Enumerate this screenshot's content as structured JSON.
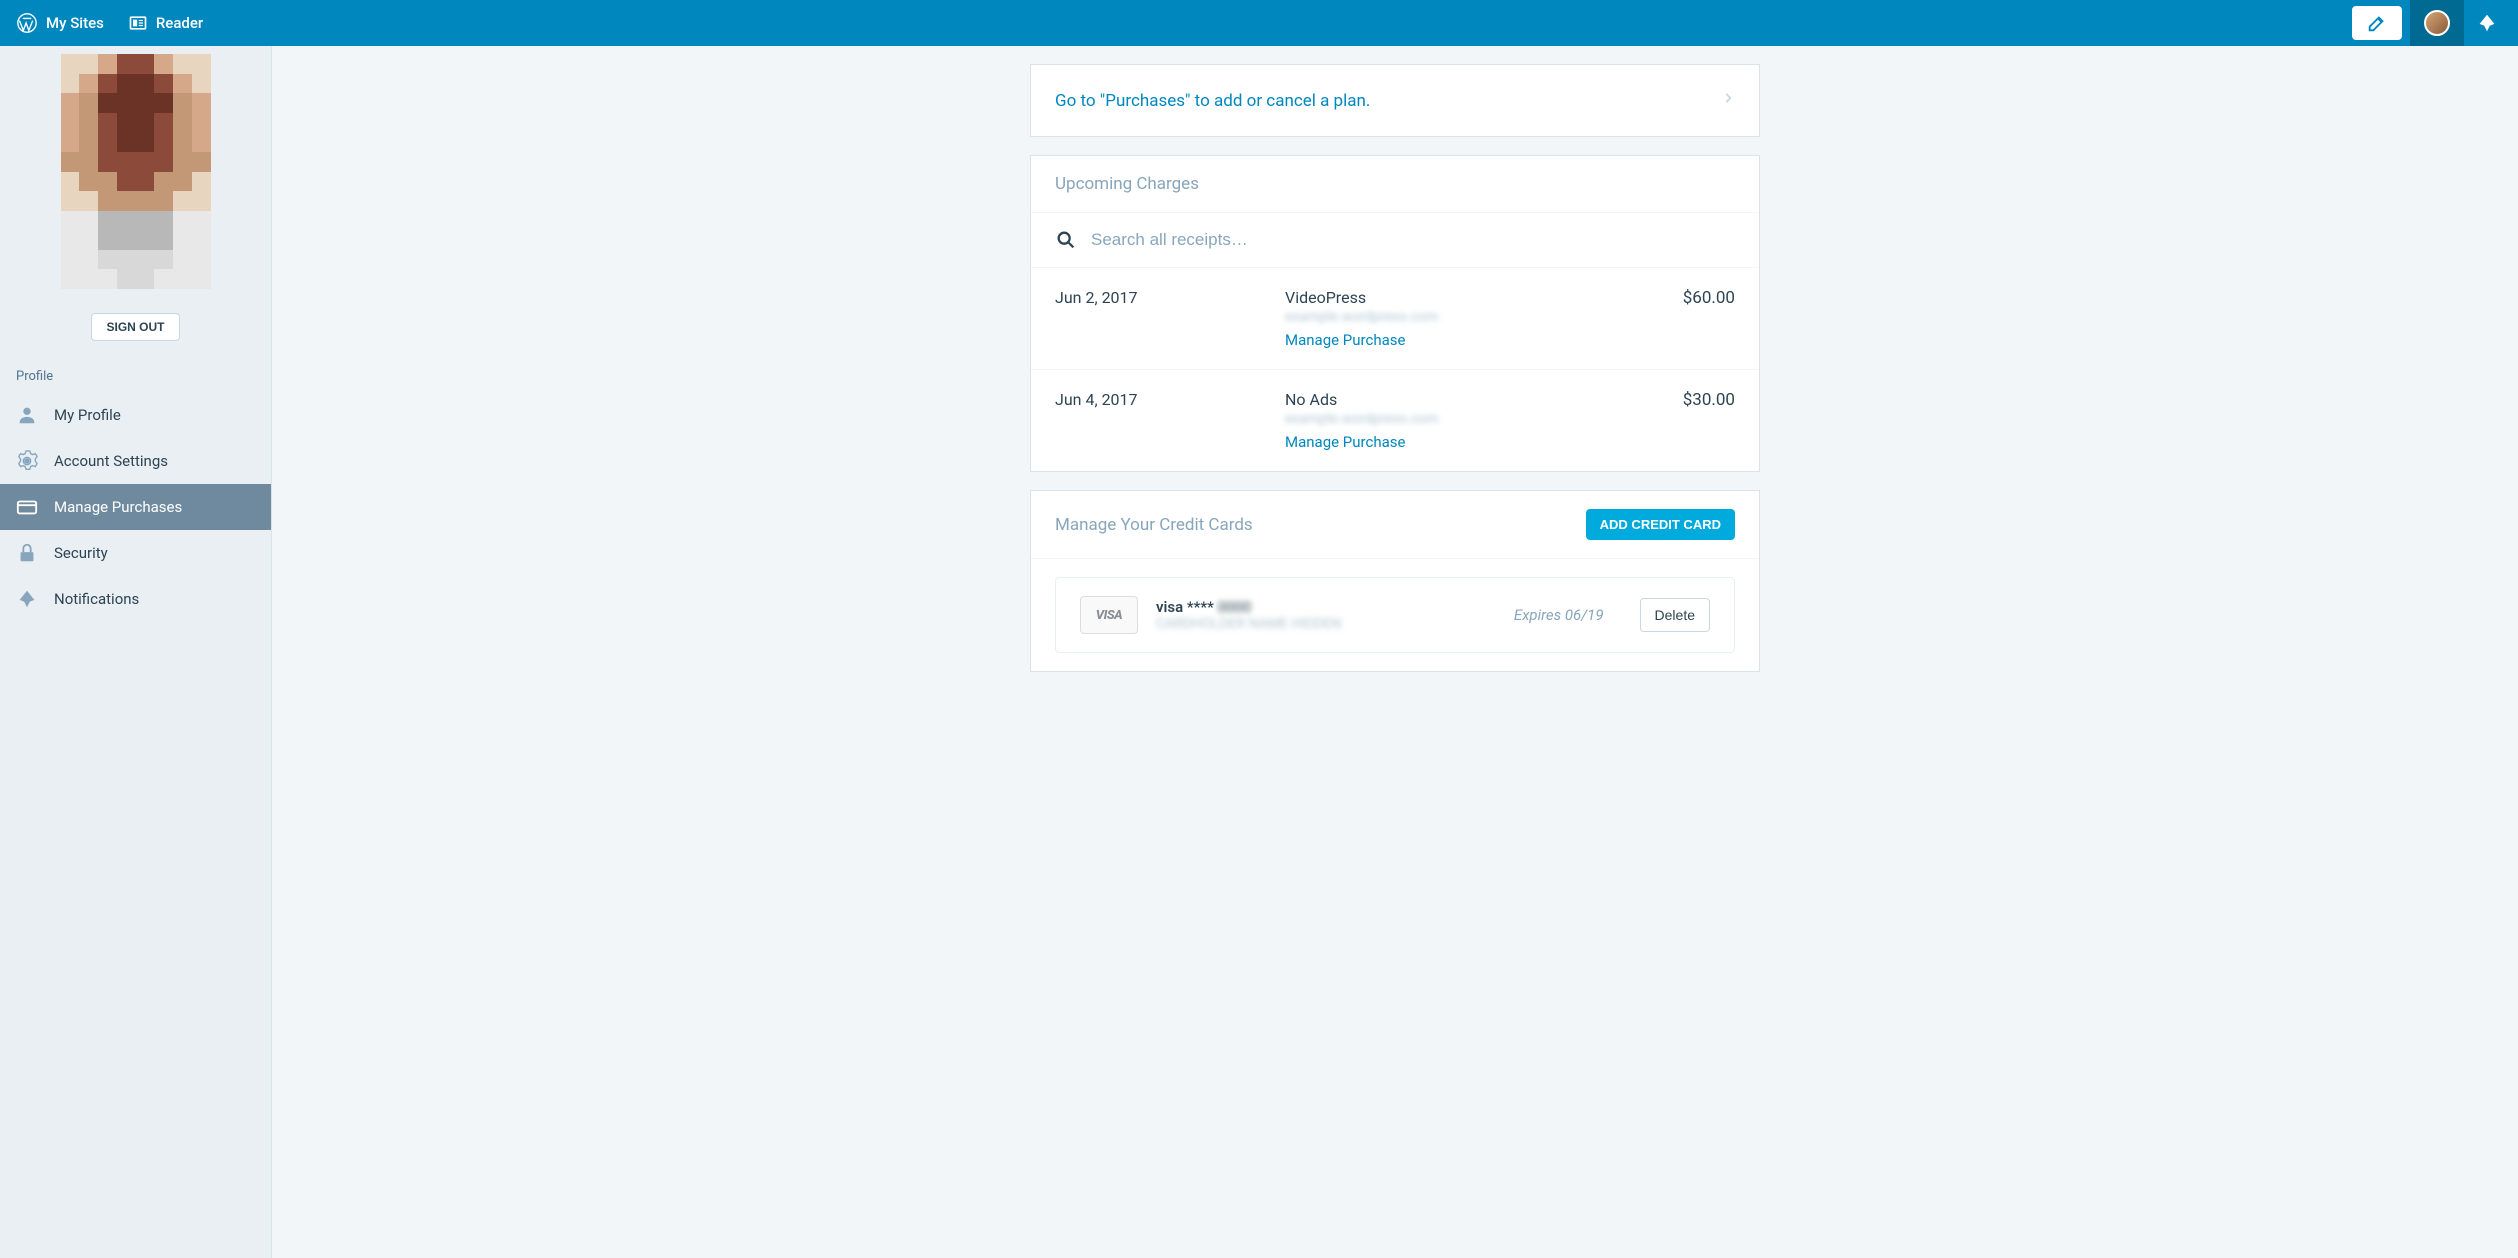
{
  "topbar": {
    "my_sites": "My Sites",
    "reader": "Reader"
  },
  "sidebar": {
    "signout": "SIGN OUT",
    "section_label": "Profile",
    "items": [
      {
        "label": "My Profile"
      },
      {
        "label": "Account Settings"
      },
      {
        "label": "Manage Purchases"
      },
      {
        "label": "Security"
      },
      {
        "label": "Notifications"
      }
    ]
  },
  "main": {
    "purchases_link": "Go to \"Purchases\" to add or cancel a plan.",
    "upcoming_header": "Upcoming Charges",
    "search_placeholder": "Search all receipts…",
    "charges": [
      {
        "date": "Jun 2, 2017",
        "title": "VideoPress",
        "manage": "Manage Purchase",
        "amount": "$60.00"
      },
      {
        "date": "Jun 4, 2017",
        "title": "No Ads",
        "manage": "Manage Purchase",
        "amount": "$30.00"
      }
    ],
    "cc_header": "Manage Your Credit Cards",
    "add_card": "ADD CREDIT CARD",
    "card": {
      "brand": "VISA",
      "title_prefix": "visa **** ",
      "expires": "Expires 06/19",
      "delete": "Delete"
    }
  }
}
